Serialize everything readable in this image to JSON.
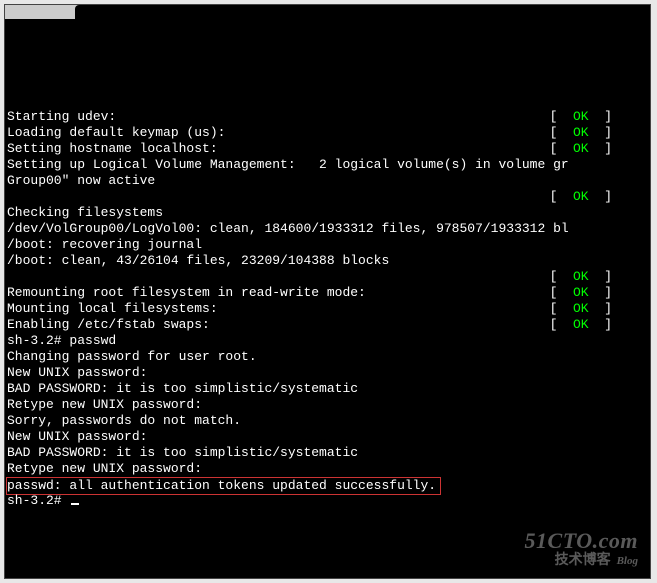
{
  "boot": {
    "lines": [
      {
        "type": "status",
        "text": "Starting udev:",
        "status": "OK"
      },
      {
        "type": "status",
        "text": "Loading default keymap (us):",
        "status": "OK"
      },
      {
        "type": "status",
        "text": "Setting hostname localhost:",
        "status": "OK"
      },
      {
        "type": "plain",
        "text": "Setting up Logical Volume Management:   2 logical volume(s) in volume gr"
      },
      {
        "type": "plain",
        "text": "Group00\" now active"
      },
      {
        "type": "status",
        "text": "",
        "status": "OK"
      },
      {
        "type": "plain",
        "text": "Checking filesystems"
      },
      {
        "type": "plain",
        "text": "/dev/VolGroup00/LogVol00: clean, 184600/1933312 files, 978507/1933312 bl"
      },
      {
        "type": "plain",
        "text": "/boot: recovering journal"
      },
      {
        "type": "plain",
        "text": "/boot: clean, 43/26104 files, 23209/104388 blocks"
      },
      {
        "type": "status",
        "text": "",
        "status": "OK"
      },
      {
        "type": "status",
        "text": "Remounting root filesystem in read-write mode:",
        "status": "OK"
      },
      {
        "type": "status",
        "text": "Mounting local filesystems:",
        "status": "OK"
      },
      {
        "type": "status",
        "text": "Enabling /etc/fstab swaps:",
        "status": "OK"
      },
      {
        "type": "plain",
        "text": "sh-3.2# passwd"
      },
      {
        "type": "plain",
        "text": "Changing password for user root."
      },
      {
        "type": "plain",
        "text": "New UNIX password:"
      },
      {
        "type": "plain",
        "text": "BAD PASSWORD: it is too simplistic/systematic"
      },
      {
        "type": "plain",
        "text": "Retype new UNIX password:"
      },
      {
        "type": "plain",
        "text": "Sorry, passwords do not match."
      },
      {
        "type": "plain",
        "text": "New UNIX password:"
      },
      {
        "type": "plain",
        "text": "BAD PASSWORD: it is too simplistic/systematic"
      },
      {
        "type": "plain",
        "text": "Retype new UNIX password:"
      },
      {
        "type": "highlight",
        "text": "passwd: all authentication tokens updated successfully."
      },
      {
        "type": "prompt",
        "text": "sh-3.2# "
      }
    ],
    "bracket_open": "[  ",
    "bracket_close": "  ]"
  },
  "watermark": {
    "line1": "51CTO.com",
    "line2": "技术博客",
    "blog": "Blog"
  }
}
